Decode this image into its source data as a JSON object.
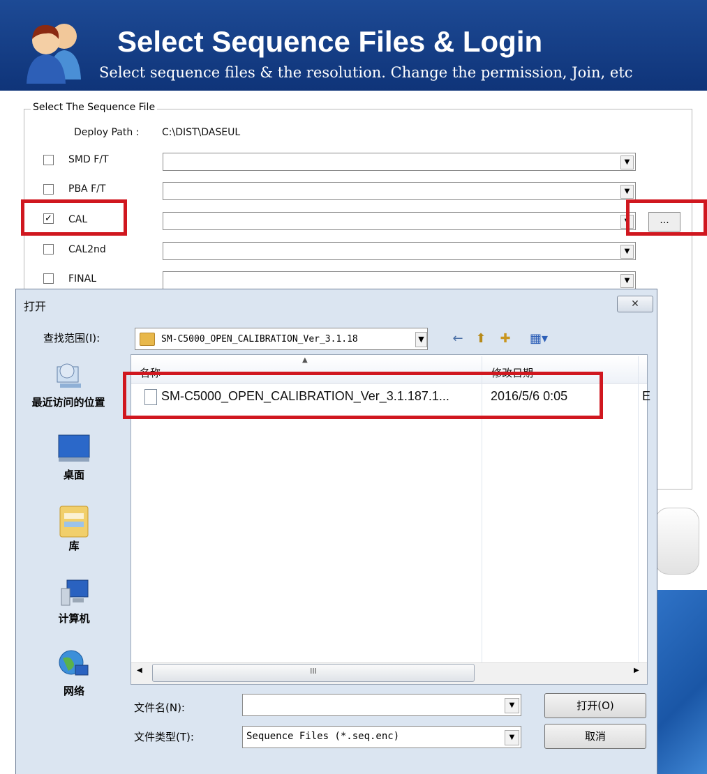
{
  "header": {
    "title": "Select Sequence Files & Login",
    "subtitle": "Select sequence files & the resolution. Change the permission, Join, etc",
    "icon": "users-icon"
  },
  "sequence_group": {
    "legend": "Select The Sequence File",
    "deploy_path_label": "Deploy Path :",
    "deploy_path_value": "C:\\DIST\\DASEUL",
    "rows": [
      {
        "label": "SMD F/T",
        "checked": false,
        "value": ""
      },
      {
        "label": "PBA F/T",
        "checked": false,
        "value": ""
      },
      {
        "label": "CAL",
        "checked": true,
        "value": ""
      },
      {
        "label": "CAL2nd",
        "checked": false,
        "value": ""
      },
      {
        "label": "FINAL",
        "checked": false,
        "value": ""
      }
    ],
    "browse_label": "...",
    "check_mark": "✓",
    "dropdown_glyph": "▼"
  },
  "dialog": {
    "title": "打开",
    "close_label": "✕",
    "look_in_label": "查找范围(I):",
    "look_in_value": "SM-C5000_OPEN_CALIBRATION_Ver_3.1.18",
    "toolbar_glyphs": {
      "back": "←",
      "up": "⬆",
      "new_folder": "✚",
      "view": "▦▾"
    },
    "places": [
      "最近访问的位置",
      "桌面",
      "库",
      "计算机",
      "网络"
    ],
    "columns": {
      "name": "名称",
      "date": "修改日期"
    },
    "files": [
      {
        "name": "SM-C5000_OPEN_CALIBRATION_Ver_3.1.187.1...",
        "date": "2016/5/6 0:05",
        "extra": "E"
      }
    ],
    "scroll_thumb": "III",
    "filename_label": "文件名(N):",
    "filename_value": "",
    "filetype_label": "文件类型(T):",
    "filetype_value": "Sequence Files (*.seq.enc)",
    "open_button": "打开(O)",
    "cancel_button": "取消"
  },
  "colors": {
    "header_bg": "#1d4a95",
    "highlight_red": "#d0171f",
    "dialog_bg": "#dbe5f1"
  }
}
